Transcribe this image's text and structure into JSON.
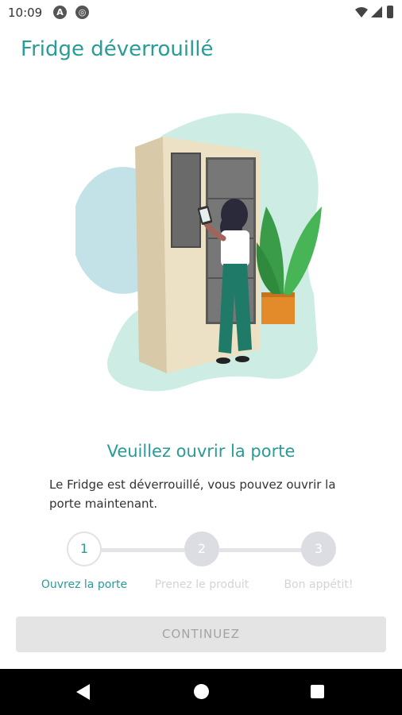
{
  "status_bar": {
    "time": "10:09"
  },
  "header": {
    "title": "Fridge déverrouillé"
  },
  "main": {
    "heading": "Veuillez ouvrir la porte",
    "description": "Le Fridge est déverrouillé, vous pouvez ouvrir la porte maintenant."
  },
  "stepper": {
    "steps": [
      {
        "number": "1",
        "label": "Ouvrez la porte",
        "state": "active"
      },
      {
        "number": "2",
        "label": "Prenez le produit",
        "state": "inactive"
      },
      {
        "number": "3",
        "label": "Bon appétit!",
        "state": "inactive"
      }
    ]
  },
  "actions": {
    "continue_label": "CONTINUEZ"
  },
  "colors": {
    "accent": "#2a9b96",
    "disabled_bg": "#e4e4e4",
    "disabled_text": "#a3a3a3"
  }
}
